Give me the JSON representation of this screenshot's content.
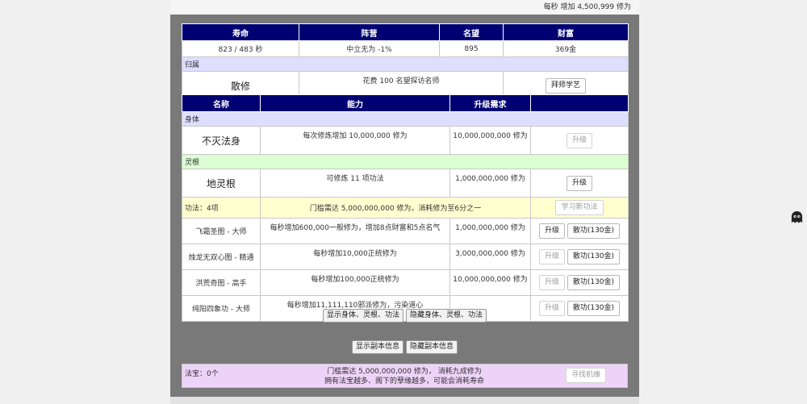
{
  "rate_text": "每秒 增加 4,500,999 修为",
  "stats": {
    "headers": [
      "寿命",
      "阵营",
      "名望",
      "财富"
    ],
    "values": [
      "823 / 483 秒",
      "中立无为 -1%",
      "895",
      "369金"
    ]
  },
  "affiliation": {
    "section_label": "归属",
    "name": "散修",
    "desc": "花费 100 名望探访名师",
    "button": "拜师学艺"
  },
  "abilities_header": [
    "名称",
    "能力",
    "升级需求",
    ""
  ],
  "body": {
    "section_label": "身体",
    "name": "不灭法身",
    "ability": "每次修炼增加 10,000,000 修为",
    "req": "10,000,000,000 修为",
    "button": "升级"
  },
  "root": {
    "section_label": "灵根",
    "name": "地灵根",
    "ability": "可修炼 11 项功法",
    "req": "1,000,000,000 修为",
    "button": "升级"
  },
  "skills": {
    "section_label": "功法：4项",
    "section_desc": "门槛需达 5,000,000,000 修为，消耗修为至6分之一",
    "learn_button": "学习新功法",
    "items": [
      {
        "name": "飞霜圣图 - 大师",
        "ability": "每秒增加600,000一般修为，增加8点财富和5点名气",
        "req": "1,000,000,000 修为",
        "upgrade": "升级",
        "scatter": "散功(130金)"
      },
      {
        "name": "烛龙无双心图 - 精通",
        "ability": "每秒增加10,000正统修为",
        "req": "3,000,000,000 修为",
        "upgrade": "升级",
        "scatter": "散功(130金)"
      },
      {
        "name": "洪荒奇图 - 高手",
        "ability": "每秒增加100,000正统修为",
        "req": "10,000,000,000 修为",
        "upgrade": "升级",
        "scatter": "散功(130金)"
      },
      {
        "name": "纯阳四象功 - 大师",
        "ability": "每秒增加11,111,110邪派修为，污染道心",
        "req": "",
        "upgrade": "升级",
        "scatter": "散功(130金)"
      }
    ]
  },
  "toggles": {
    "show_body": "显示身体、灵根、功法",
    "hide_body": "隐藏身体、灵根、功法",
    "show_dungeon": "显示副本信息",
    "hide_dungeon": "隐藏副本信息"
  },
  "treasure": {
    "label": "法宝：0个",
    "line1": "门槛需达 5,000,000,000 修为， 消耗九成修为",
    "line2": "拥有法宝越多、阁下的孽缘越多，可能会消耗寿命",
    "button": "寻找机缘"
  },
  "icons": {
    "side_icon": "ghost-icon"
  }
}
